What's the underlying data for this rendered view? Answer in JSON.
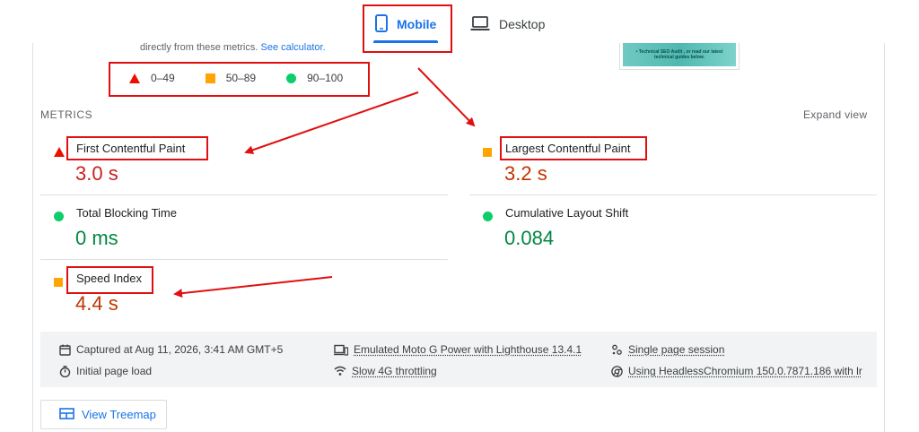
{
  "tabs": {
    "mobile_label": "Mobile",
    "desktop_label": "Desktop",
    "active": "Mobile"
  },
  "intro": {
    "text": "directly from these metrics.",
    "link": "See calculator."
  },
  "thumbnail": {
    "line1": "• Technical SEO Audit , or read our latest",
    "line2": "technical guides below."
  },
  "legend": {
    "fail_range": "0–49",
    "average_range": "50–89",
    "pass_range": "90–100"
  },
  "metrics": {
    "header": "METRICS",
    "expand_label": "Expand view",
    "fcp": {
      "label": "First Contentful Paint",
      "value": "3.0 s",
      "rating": "fail"
    },
    "lcp": {
      "label": "Largest Contentful Paint",
      "value": "3.2 s",
      "rating": "average"
    },
    "tbt": {
      "label": "Total Blocking Time",
      "value": "0 ms",
      "rating": "pass"
    },
    "cls": {
      "label": "Cumulative Layout Shift",
      "value": "0.084",
      "rating": "pass"
    },
    "si": {
      "label": "Speed Index",
      "value": "4.4 s",
      "rating": "average"
    }
  },
  "runtime": {
    "captured": "Captured at Aug 11, 2026, 3:41 AM GMT+5",
    "page_load": "Initial page load",
    "device": "Emulated Moto G Power with Lighthouse 13.4.1",
    "throttling": "Slow 4G throttling",
    "session": "Single page session",
    "browser": "Using HeadlessChromium 150.0.7871.186 with lr"
  },
  "treemap": {
    "label": "View Treemap"
  },
  "colors": {
    "accent": "#1a73e8",
    "fail": "#eb0f00",
    "average": "#ffa400",
    "pass": "#0cce6b",
    "annotation": "#e01010"
  }
}
